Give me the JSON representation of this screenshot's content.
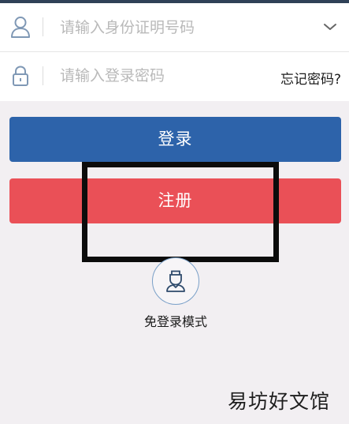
{
  "form": {
    "id_placeholder": "请输入身份证明号码",
    "password_placeholder": "请输入登录密码",
    "forgot_password": "忘记密码?"
  },
  "buttons": {
    "login": "登录",
    "register": "注册"
  },
  "guest_mode": {
    "label": "免登录模式"
  },
  "watermark": "易坊好文馆",
  "colors": {
    "login_button": "#2d63aa",
    "register_button": "#ea5057",
    "background": "#f2eff2",
    "highlight_border": "#0c0c0c"
  },
  "icons": {
    "id_field": "user-icon",
    "password_field": "lock-icon",
    "dropdown": "chevron-down-icon",
    "guest": "person-icon"
  }
}
